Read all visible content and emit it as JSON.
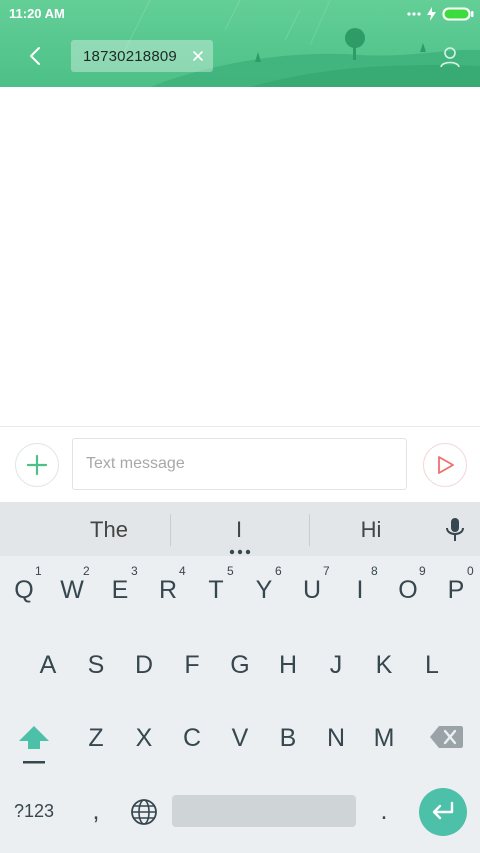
{
  "status_bar": {
    "time": "11:20 AM"
  },
  "header": {
    "recipient": "18730218809"
  },
  "compose": {
    "placeholder": "Text message"
  },
  "keyboard": {
    "suggestions": [
      "The",
      "I",
      "Hi"
    ],
    "row1": [
      {
        "letter": "Q",
        "num": "1"
      },
      {
        "letter": "W",
        "num": "2"
      },
      {
        "letter": "E",
        "num": "3"
      },
      {
        "letter": "R",
        "num": "4"
      },
      {
        "letter": "T",
        "num": "5"
      },
      {
        "letter": "Y",
        "num": "6"
      },
      {
        "letter": "U",
        "num": "7"
      },
      {
        "letter": "I",
        "num": "8"
      },
      {
        "letter": "O",
        "num": "9"
      },
      {
        "letter": "P",
        "num": "0"
      }
    ],
    "row2": [
      "A",
      "S",
      "D",
      "F",
      "G",
      "H",
      "J",
      "K",
      "L"
    ],
    "row3": [
      "Z",
      "X",
      "C",
      "V",
      "B",
      "N",
      "M"
    ],
    "symbols_label": "?123",
    "comma": ",",
    "period": "."
  },
  "colors": {
    "accent": "#4cc088",
    "send": "#ef6f6f",
    "keyboard_bg": "#eceff1"
  }
}
